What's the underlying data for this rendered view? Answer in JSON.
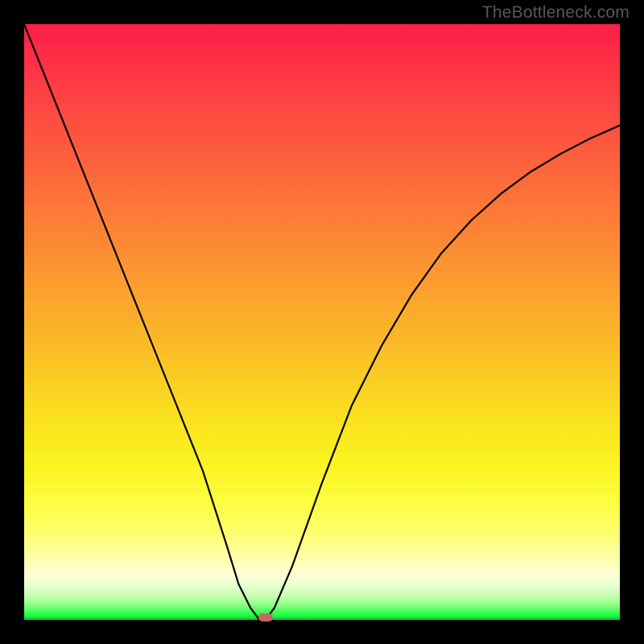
{
  "watermark": "TheBottleneck.com",
  "chart_data": {
    "type": "line",
    "title": "",
    "xlabel": "",
    "ylabel": "",
    "xlim": [
      0,
      1
    ],
    "ylim": [
      0,
      1
    ],
    "series": [
      {
        "name": "bottleneck-curve",
        "x": [
          0.0,
          0.05,
          0.1,
          0.15,
          0.2,
          0.25,
          0.3,
          0.34,
          0.36,
          0.38,
          0.395,
          0.405,
          0.42,
          0.45,
          0.5,
          0.55,
          0.6,
          0.65,
          0.7,
          0.75,
          0.8,
          0.85,
          0.9,
          0.95,
          1.0
        ],
        "y": [
          1.0,
          0.875,
          0.75,
          0.625,
          0.5,
          0.375,
          0.25,
          0.125,
          0.06,
          0.02,
          0.0,
          0.0,
          0.02,
          0.09,
          0.23,
          0.36,
          0.46,
          0.545,
          0.615,
          0.67,
          0.715,
          0.752,
          0.782,
          0.808,
          0.83
        ]
      }
    ],
    "marker": {
      "x": 0.405,
      "y": 0.004
    },
    "gradient_colors": {
      "top": "#fe1e4a",
      "mid_upper": "#fc7e36",
      "mid": "#fae31e",
      "mid_lower": "#ffffd2",
      "bottom": "#09c237"
    }
  }
}
